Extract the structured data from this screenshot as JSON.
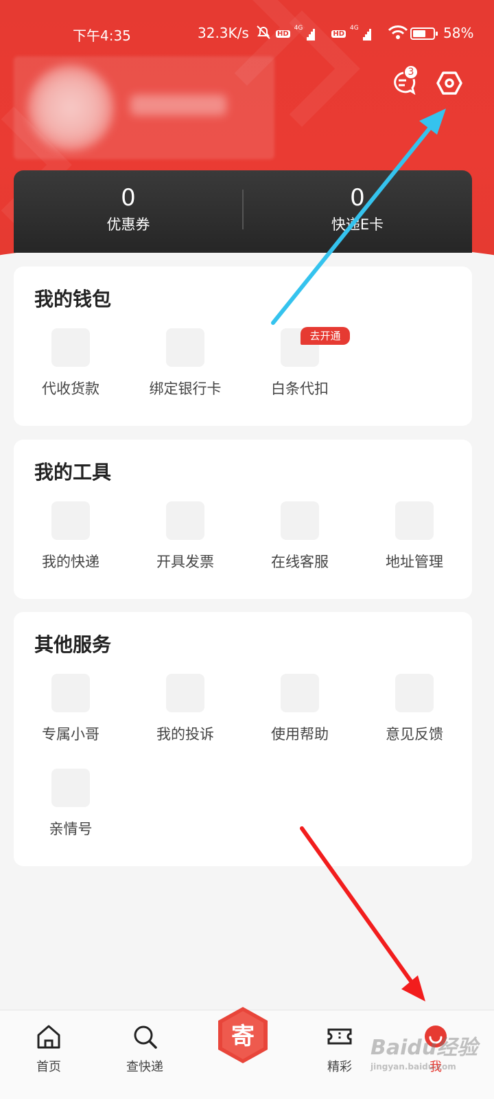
{
  "status_bar": {
    "time": "下午4:35",
    "network_speed": "32.3K/s",
    "network_type_1": "4G",
    "network_type_2": "4G",
    "hd_1": "HD",
    "hd_2": "HD",
    "battery_level": 0.58,
    "battery_text": "58%"
  },
  "header": {
    "message_badge_count": "3",
    "stats": [
      {
        "value": "0",
        "label": "优惠券"
      },
      {
        "value": "0",
        "label": "快递E卡"
      }
    ]
  },
  "wallet": {
    "title": "我的钱包",
    "items": [
      {
        "label": "代收货款"
      },
      {
        "label": "绑定银行卡"
      },
      {
        "label": "白条代扣"
      }
    ],
    "tag": "去开通"
  },
  "tools": {
    "title": "我的工具",
    "items": [
      {
        "label": "我的快递"
      },
      {
        "label": "开具发票"
      },
      {
        "label": "在线客服"
      },
      {
        "label": "地址管理"
      }
    ]
  },
  "other": {
    "title": "其他服务",
    "items": [
      {
        "label": "专属小哥"
      },
      {
        "label": "我的投诉"
      },
      {
        "label": "使用帮助"
      },
      {
        "label": "意见反馈"
      },
      {
        "label": "亲情号"
      }
    ]
  },
  "bottom_nav": {
    "items": [
      {
        "label": "首页",
        "icon": "home-icon"
      },
      {
        "label": "查快递",
        "icon": "search-icon"
      },
      {
        "label": "寄",
        "icon": "send-icon"
      },
      {
        "label": "精彩",
        "icon": "ticket-icon"
      },
      {
        "label": "我",
        "icon": "profile-icon"
      }
    ]
  },
  "watermark": {
    "brand": "Baidu经验",
    "url": "jingyan.baidu.com"
  },
  "colors": {
    "accent": "#e63a32",
    "dark_card": "#2e2e2e",
    "background": "#f5f5f5",
    "annotation_blue": "#35c3ee",
    "annotation_red": "#f21d1d"
  }
}
